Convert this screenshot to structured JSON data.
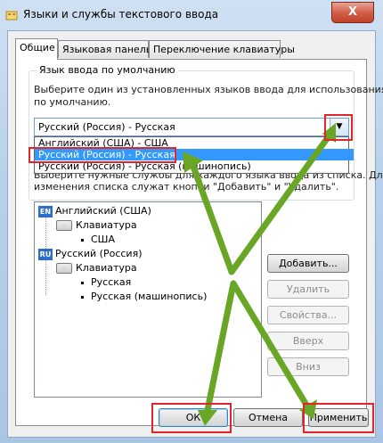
{
  "window": {
    "title": "Языки и службы текстового ввода",
    "close_label": "X",
    "background_hint": "Calibri (Осно"
  },
  "tabs": [
    {
      "label": "Общие",
      "active": true
    },
    {
      "label": "Языковая панель",
      "active": false
    },
    {
      "label": "Переключение клавиатуры",
      "active": false
    }
  ],
  "default_lang": {
    "group_title": "Язык ввода по умолчанию",
    "description_line1": "Выберите один из установленных языков ввода для использования",
    "description_line2": "по умолчанию.",
    "selected": "Русский (Россия) - Русская",
    "options": [
      "Английский (США) - США",
      "Русский (Россия) - Русская",
      "Русский (Россия) - Русская (машинопись)"
    ],
    "highlighted_index": 1
  },
  "services": {
    "text_line1": "Выберите нужные службы для каждого языка ввода из списка. Для",
    "text_line2": "изменения списка служат кнопки \"Добавить\" и \"Удалить\".",
    "tree": [
      {
        "badge": "EN",
        "lang": "Английский (США)",
        "group": "Клавиатура",
        "layouts": [
          "США"
        ]
      },
      {
        "badge": "RU",
        "lang": "Русский (Россия)",
        "group": "Клавиатура",
        "layouts": [
          "Русская",
          "Русская (машинопись)"
        ]
      }
    ],
    "buttons": {
      "add": "Добавить...",
      "remove": "Удалить",
      "properties": "Свойства...",
      "up": "Вверх",
      "down": "Вниз"
    }
  },
  "footer": {
    "ok": "ОК",
    "cancel": "Отмена",
    "apply": "Применить"
  },
  "colors": {
    "annotation_red": "#e0262c",
    "annotation_arrow": "#6aa626",
    "selection_blue": "#3399ff"
  }
}
